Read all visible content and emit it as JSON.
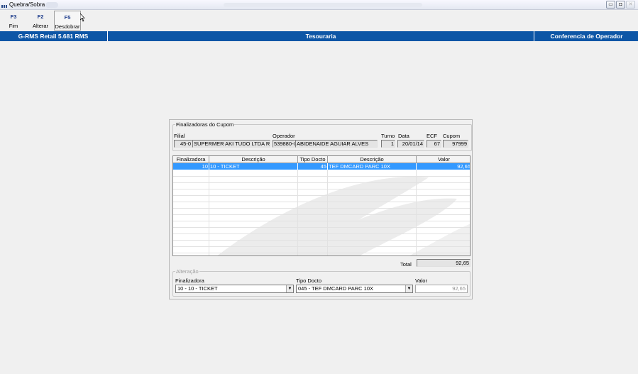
{
  "window": {
    "title": "Quebra/Sobra",
    "controls": {
      "minimize": "▭",
      "maximize": "◘",
      "close": "✕"
    }
  },
  "toolbar": [
    {
      "key": "F3",
      "label": "Fim"
    },
    {
      "key": "F2",
      "label": "Alterar"
    },
    {
      "key": "F5",
      "label": "Desdobrar"
    }
  ],
  "header": {
    "left": "G-RMS Retail 5.681 RMS",
    "center": "Tesouraria",
    "right": "Conferencia de Operador"
  },
  "cupom": {
    "legend": "Finalizadoras do Cupom",
    "labels": {
      "filial": "Filial",
      "operador": "Operador",
      "turno": "Turno",
      "data": "Data",
      "ecf": "ECF",
      "cupom": "Cupom"
    },
    "values": {
      "filial_code": "45-0",
      "filial_name": "SUPERMER AKI TUDO LTDA RK",
      "operador_code": "539880-0",
      "operador_name": "ABIDENAIDE AGUIAR ALVES",
      "turno": "1",
      "data": "20/01/14",
      "ecf": "67",
      "cupom": "97999"
    }
  },
  "grid": {
    "columns": [
      "Finalizadora",
      "Descrição",
      "Tipo Docto",
      "Descrição",
      "Valor"
    ],
    "rows": [
      {
        "finalizadora": "10",
        "descricao": "10 - TICKET",
        "tipo_docto": "45",
        "descricao2": "TEF DMCARD PARC 10X",
        "valor": "92,65"
      }
    ]
  },
  "total": {
    "label": "Total",
    "value": "92,65"
  },
  "alteracao": {
    "legend": "Alteração",
    "labels": {
      "finalizadora": "Finalizadora",
      "tipo_docto": "Tipo Docto",
      "valor": "Valor"
    },
    "finalizadora_value": "10 - 10 - TICKET",
    "tipo_docto_value": "045 - TEF DMCARD PARC 10X",
    "valor_value": "92,65"
  },
  "colors": {
    "header_band": "#0d56a6",
    "selected_row": "#3399ff"
  }
}
